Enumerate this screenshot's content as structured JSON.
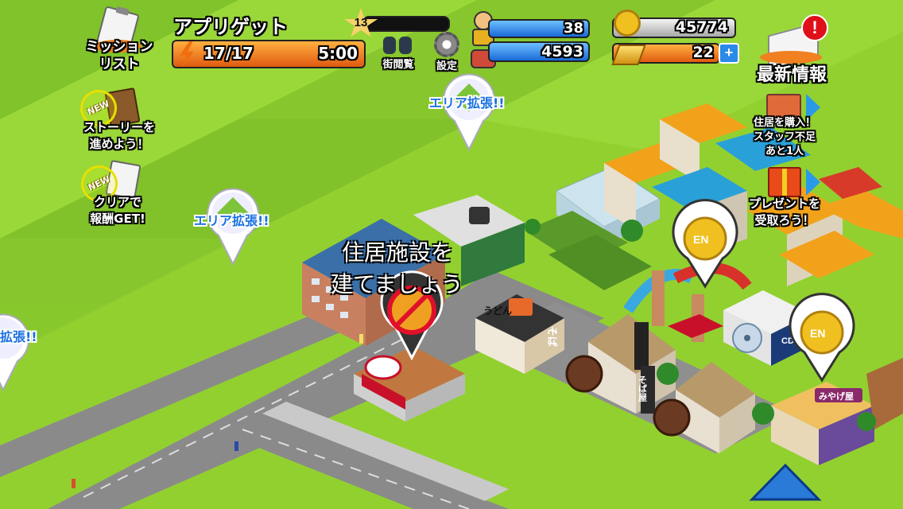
{
  "hud": {
    "title": "アプリゲット",
    "energy": "17/17",
    "timer": "5:00",
    "level": "13",
    "binoculars_label": "街閲覧",
    "settings_label": "設定",
    "population": "38",
    "staff": "4593",
    "coins": "45774",
    "gold": "22",
    "plus": "+",
    "news_label": "最新情報",
    "news_alert": "!"
  },
  "side_menu": {
    "mission_list": "ミッション\nリスト",
    "story": "ストーリーを\n進めよう！",
    "clear_reward": "クリアで\n報酬GET!",
    "new_badge": "NEW"
  },
  "right_panel": {
    "buy_house": "住居を購入！\nスタッフ不足\nあと1人",
    "present": "プレゼントを\n受取ろう！"
  },
  "map": {
    "area_expand": "エリア拡張!!",
    "area_expand_clipped": "拡張!!",
    "hint_line1": "住居施設を",
    "hint_line2": "建てましょう",
    "coin_label": "EN",
    "udon_sign": "うどん",
    "soba_sign": "そば",
    "soba_shop_sign": "そば屋",
    "omiyage_sign": "みやげ屋",
    "cd_sign": "CD"
  }
}
